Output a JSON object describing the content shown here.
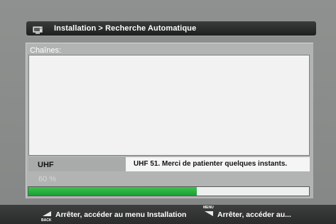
{
  "header": {
    "title": "Installation > Recherche Automatique",
    "icon": "tv-icon"
  },
  "panel": {
    "channels_label": "Chaînes:"
  },
  "scan": {
    "band": "UHF",
    "status": "UHF 51.  Merci de patienter quelques instants.",
    "percent_text": "60 %",
    "progress": 0.6
  },
  "footer": {
    "hints": [
      {
        "key_caption": "BACK",
        "text": "Arrêter, accéder au menu Installation",
        "icon": "back-key-icon"
      },
      {
        "key_caption": "MENU",
        "text": "Arrêter, accéder au...",
        "icon": "menu-key-icon"
      }
    ]
  },
  "colors": {
    "progress_fill": "#22a83a",
    "background": "#8a8c8b",
    "title_bar": "#2b2c2c"
  }
}
